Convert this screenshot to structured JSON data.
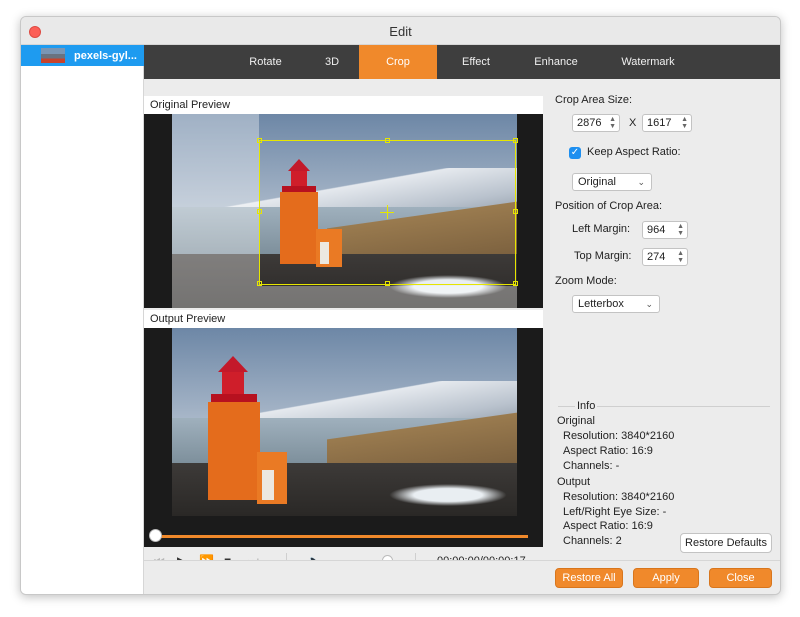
{
  "window": {
    "title": "Edit"
  },
  "sidebar": {
    "file_name": "pexels-gyl..."
  },
  "tabs": [
    {
      "label": "Rotate",
      "active": false
    },
    {
      "label": "3D",
      "active": false
    },
    {
      "label": "Crop",
      "active": true
    },
    {
      "label": "Effect",
      "active": false
    },
    {
      "label": "Enhance",
      "active": false
    },
    {
      "label": "Watermark",
      "active": false
    }
  ],
  "preview": {
    "original_label": "Original Preview",
    "output_label": "Output Preview"
  },
  "playback": {
    "timecode": "00:00:00/00:00:17",
    "progress": 0,
    "volume": 0.9
  },
  "crop": {
    "area_size_label": "Crop Area Size:",
    "width": "2876",
    "x_sep": "X",
    "height": "1617",
    "keep_aspect_label": "Keep Aspect Ratio:",
    "keep_aspect_checked": true,
    "aspect_select": "Original",
    "position_label": "Position of Crop Area:",
    "left_margin_label": "Left Margin:",
    "left_margin": "964",
    "top_margin_label": "Top Margin:",
    "top_margin": "274",
    "zoom_mode_label": "Zoom Mode:",
    "zoom_mode": "Letterbox"
  },
  "info": {
    "title": "Info",
    "original_heading": "Original",
    "original_resolution": "Resolution: 3840*2160",
    "original_aspect": "Aspect Ratio: 16:9",
    "original_channels": "Channels: -",
    "output_heading": "Output",
    "output_resolution": "Resolution: 3840*2160",
    "output_eye_size": "Left/Right Eye Size: -",
    "output_aspect": "Aspect Ratio: 16:9",
    "output_channels": "Channels: 2"
  },
  "buttons": {
    "restore_defaults": "Restore Defaults",
    "restore_all": "Restore All",
    "apply": "Apply",
    "close": "Close"
  },
  "colors": {
    "accent": "#f0892b",
    "selection": "#1e9bf0",
    "tabbar": "#3e3e3e",
    "crop_frame": "#e6e600"
  }
}
